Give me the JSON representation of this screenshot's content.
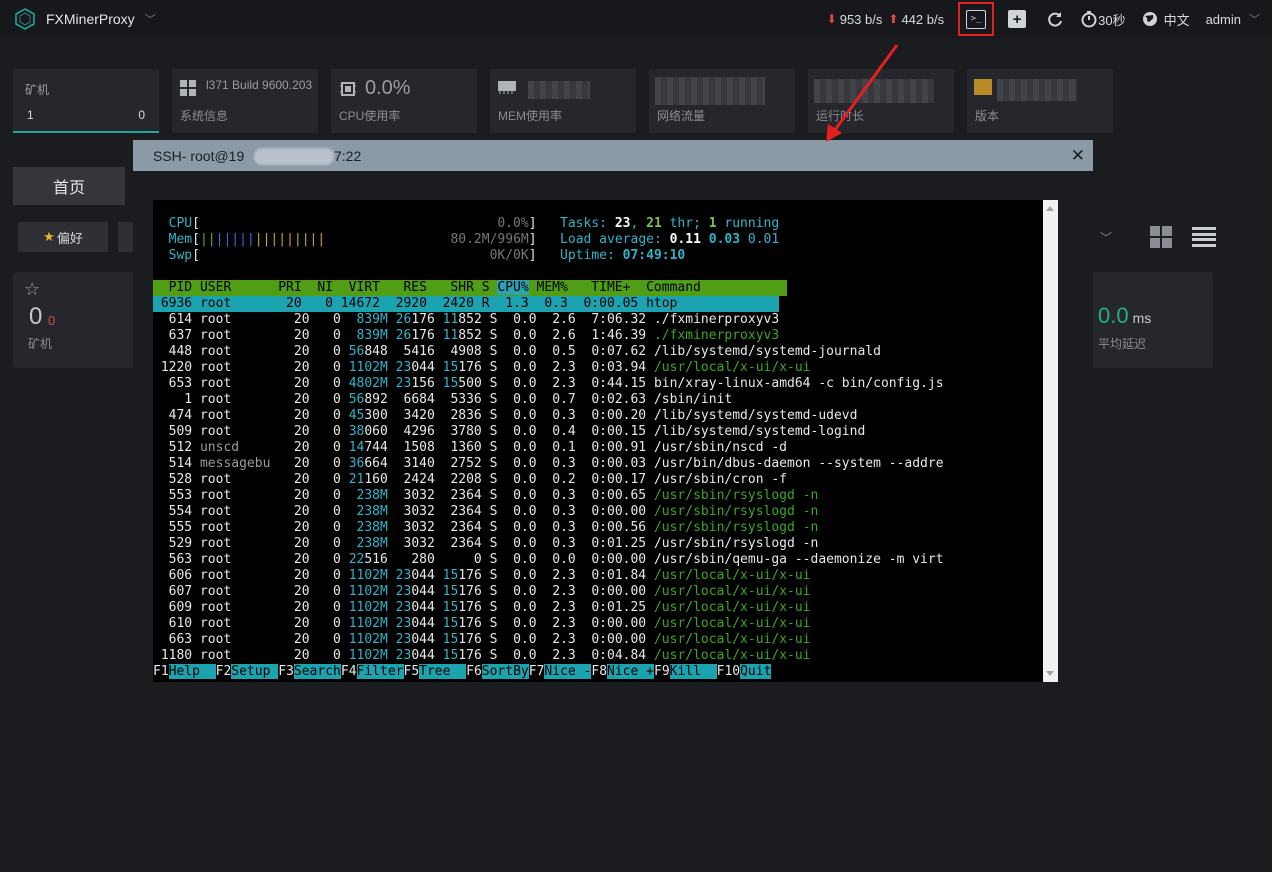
{
  "app": {
    "name": "FXMinerProxy"
  },
  "topbar": {
    "down_rate": "953 b/s",
    "up_rate": "442 b/s",
    "refresh_interval": "30秒",
    "language": "中文",
    "user": "admin"
  },
  "cards": [
    {
      "label": "矿机",
      "left": "1",
      "right": "0"
    },
    {
      "label": "系统信息",
      "value": "l371 Build 9600.203"
    },
    {
      "label": "CPU使用率",
      "value": "0.0%"
    },
    {
      "label": "MEM使用率"
    },
    {
      "label": "网络流量"
    },
    {
      "label": "运行时长"
    },
    {
      "label": "版本"
    }
  ],
  "home_tab": "首页",
  "favorite_button": "偏好",
  "stats": {
    "miners_count": "0",
    "miners_offline": "0",
    "miners_label": "矿机",
    "latency_value": "0.0",
    "latency_unit": "ms",
    "latency_label": "平均延迟"
  },
  "modal": {
    "title_prefix": "SSH- root@19",
    "title_suffix": "7:22",
    "close": "✕"
  },
  "htop": {
    "cpu_label": "CPU",
    "cpu_value": "0.0%",
    "mem_label": "Mem",
    "mem_value": "80.2M/996M",
    "swp_label": "Swp",
    "swp_value": "0K/0K",
    "tasks": "23",
    "threads": "21",
    "running": "1",
    "load1": "0.11",
    "load5": "0.03",
    "load15": "0.01",
    "uptime": "07:49:10",
    "header": "  PID USER      PRI  NI  VIRT   RES   SHR S CPU% MEM%   TIME+  Command           ",
    "selected": " 6936 root       20   0 14672  2920  2420 R  1.3  0.3  0:00.05 htop             ",
    "processes": [
      [
        "  614",
        "root     ",
        "20",
        "0",
        "839M",
        "26176",
        "11852",
        "S",
        "0.0",
        "2.6",
        " 7:06.32",
        "./fxminerproxyv3",
        "w"
      ],
      [
        "  637",
        "root     ",
        "20",
        "0",
        "839M",
        "26176",
        "11852",
        "S",
        "0.0",
        "2.6",
        " 1:46.39",
        "./fxminerproxyv3",
        "g"
      ],
      [
        "  448",
        "root     ",
        "20",
        "0",
        "56848",
        "5416",
        "4908",
        "S",
        "0.0",
        "0.5",
        " 0:07.62",
        "/lib/systemd/systemd-journald",
        "w"
      ],
      [
        " 1220",
        "root     ",
        "20",
        "0",
        "1102M",
        "23044",
        "15176",
        "S",
        "0.0",
        "2.3",
        " 0:03.94",
        "/usr/local/x-ui/x-ui",
        "g"
      ],
      [
        "  653",
        "root     ",
        "20",
        "0",
        "4802M",
        "23156",
        "15500",
        "S",
        "0.0",
        "2.3",
        " 0:44.15",
        "bin/xray-linux-amd64 -c bin/config.js",
        "w"
      ],
      [
        "    1",
        "root     ",
        "20",
        "0",
        "56892",
        "6684",
        "5336",
        "S",
        "0.0",
        "0.7",
        " 0:02.63",
        "/sbin/init",
        "w"
      ],
      [
        "  474",
        "root     ",
        "20",
        "0",
        "45300",
        "3420",
        "2836",
        "S",
        "0.0",
        "0.3",
        " 0:00.20",
        "/lib/systemd/systemd-udevd",
        "w"
      ],
      [
        "  509",
        "root     ",
        "20",
        "0",
        "38060",
        "4296",
        "3780",
        "S",
        "0.0",
        "0.4",
        " 0:00.15",
        "/lib/systemd/systemd-logind",
        "w"
      ],
      [
        "  512",
        "unscd    ",
        "20",
        "0",
        "14744",
        "1508",
        "1360",
        "S",
        "0.0",
        "0.1",
        " 0:00.91",
        "/usr/sbin/nscd -d",
        "w"
      ],
      [
        "  514",
        "messagebu",
        "20",
        "0",
        "36664",
        "3140",
        "2752",
        "S",
        "0.0",
        "0.3",
        " 0:00.03",
        "/usr/bin/dbus-daemon --system --addre",
        "w"
      ],
      [
        "  528",
        "root     ",
        "20",
        "0",
        "21160",
        "2424",
        "2208",
        "S",
        "0.0",
        "0.2",
        " 0:00.17",
        "/usr/sbin/cron -f",
        "w"
      ],
      [
        "  553",
        "root     ",
        "20",
        "0",
        "238M",
        "3032",
        "2364",
        "S",
        "0.0",
        "0.3",
        " 0:00.65",
        "/usr/sbin/rsyslogd -n",
        "g"
      ],
      [
        "  554",
        "root     ",
        "20",
        "0",
        "238M",
        "3032",
        "2364",
        "S",
        "0.0",
        "0.3",
        " 0:00.00",
        "/usr/sbin/rsyslogd -n",
        "g"
      ],
      [
        "  555",
        "root     ",
        "20",
        "0",
        "238M",
        "3032",
        "2364",
        "S",
        "0.0",
        "0.3",
        " 0:00.56",
        "/usr/sbin/rsyslogd -n",
        "g"
      ],
      [
        "  529",
        "root     ",
        "20",
        "0",
        "238M",
        "3032",
        "2364",
        "S",
        "0.0",
        "0.3",
        " 0:01.25",
        "/usr/sbin/rsyslogd -n",
        "w"
      ],
      [
        "  563",
        "root     ",
        "20",
        "0",
        "22516",
        "280",
        "0",
        "S",
        "0.0",
        "0.0",
        " 0:00.00",
        "/usr/sbin/qemu-ga --daemonize -m virt",
        "w"
      ],
      [
        "  606",
        "root     ",
        "20",
        "0",
        "1102M",
        "23044",
        "15176",
        "S",
        "0.0",
        "2.3",
        " 0:01.84",
        "/usr/local/x-ui/x-ui",
        "g"
      ],
      [
        "  607",
        "root     ",
        "20",
        "0",
        "1102M",
        "23044",
        "15176",
        "S",
        "0.0",
        "2.3",
        " 0:00.00",
        "/usr/local/x-ui/x-ui",
        "g"
      ],
      [
        "  609",
        "root     ",
        "20",
        "0",
        "1102M",
        "23044",
        "15176",
        "S",
        "0.0",
        "2.3",
        " 0:01.25",
        "/usr/local/x-ui/x-ui",
        "g"
      ],
      [
        "  610",
        "root     ",
        "20",
        "0",
        "1102M",
        "23044",
        "15176",
        "S",
        "0.0",
        "2.3",
        " 0:00.00",
        "/usr/local/x-ui/x-ui",
        "g"
      ],
      [
        "  663",
        "root     ",
        "20",
        "0",
        "1102M",
        "23044",
        "15176",
        "S",
        "0.0",
        "2.3",
        " 0:00.00",
        "/usr/local/x-ui/x-ui",
        "g"
      ],
      [
        " 1180",
        "root     ",
        "20",
        "0",
        "1102M",
        "23044",
        "15176",
        "S",
        "0.0",
        "2.3",
        " 0:04.84",
        "/usr/local/x-ui/x-ui",
        "g"
      ]
    ],
    "fkeys": [
      [
        "F1",
        "Help  "
      ],
      [
        "F2",
        "Setup "
      ],
      [
        "F3",
        "Search"
      ],
      [
        "F4",
        "Filter"
      ],
      [
        "F5",
        "Tree  "
      ],
      [
        "F6",
        "SortBy"
      ],
      [
        "F7",
        "Nice -"
      ],
      [
        "F8",
        "Nice +"
      ],
      [
        "F9",
        "Kill  "
      ],
      [
        "F10",
        "Quit"
      ]
    ]
  },
  "colors": {
    "accent_teal": "#20a69a",
    "latency_green": "#22b07d",
    "alert_red": "#e04848",
    "annotation_red": "#e62020"
  }
}
